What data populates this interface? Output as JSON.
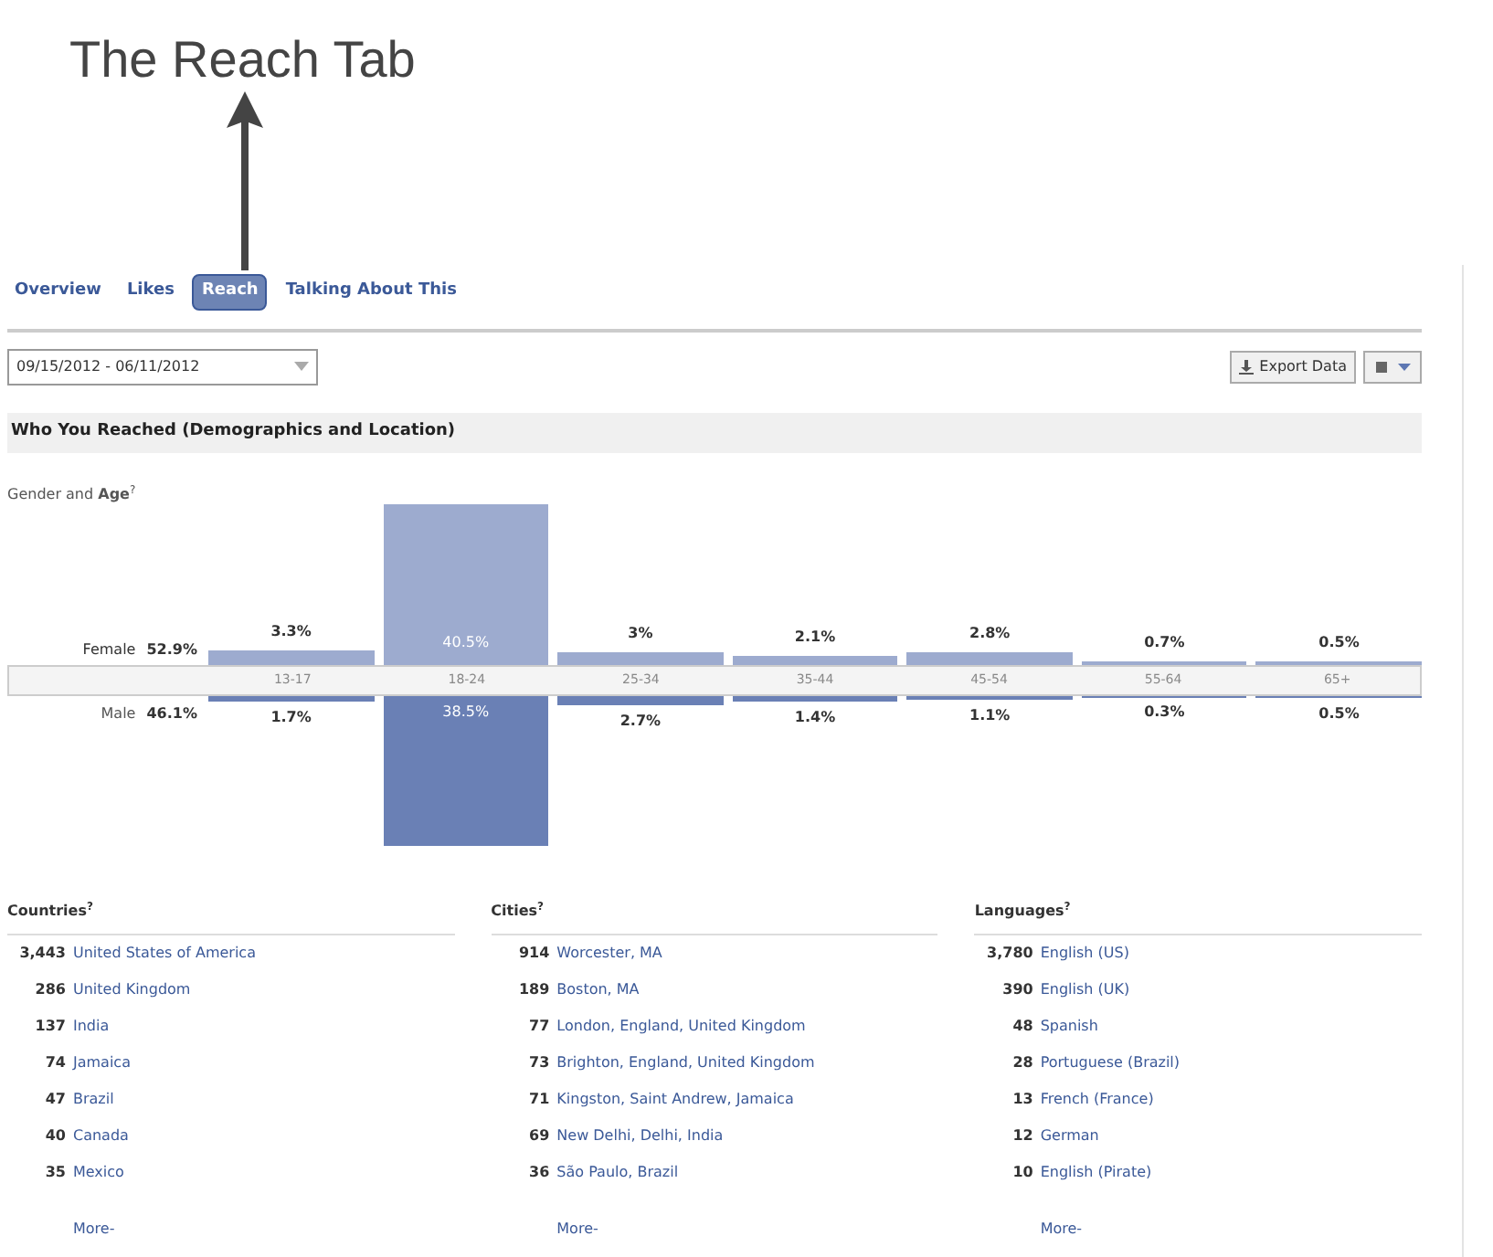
{
  "annotation": {
    "title": "The Reach Tab"
  },
  "tabs": [
    {
      "label": "Overview",
      "selected": false
    },
    {
      "label": "Likes",
      "selected": false
    },
    {
      "label": "Reach",
      "selected": true
    },
    {
      "label": "Talking About This",
      "selected": false
    }
  ],
  "date_range": {
    "value": "09/15/2012 - 06/11/2012"
  },
  "export_button": "Export Data",
  "section": {
    "title": "Who You Reached (Demographics and Location)",
    "chart_title": "Gender and **Age**$^{?}$",
    "gender_totals": [
      {
        "label": "Female",
        "value": "52.9%"
      },
      {
        "label": "Male",
        "value": "46.1%"
      }
    ],
    "age_groups": [
      {
        "label": "13-17",
        "female": "3.3%",
        "male": "1.7%"
      },
      {
        "label": "18-24",
        "female": "40.5%",
        "male": "38.5%"
      },
      {
        "label": "25-34",
        "female": "3%",
        "male": "2.7%"
      },
      {
        "label": "35-44",
        "female": "2.1%",
        "male": "1.4%"
      },
      {
        "label": "45-54",
        "female": "2.8%",
        "male": "1.1%"
      },
      {
        "label": "55-64",
        "female": "0.7%",
        "male": "0.3%"
      },
      {
        "label": "65+",
        "female": "0.5%",
        "male": "0.5%"
      }
    ]
  },
  "lists": [
    {
      "title": "Countries$^{?}$",
      "rows": [
        {
          "count": "3,443",
          "name": "United States of America"
        },
        {
          "count": "286",
          "name": "United Kingdom"
        },
        {
          "count": "137",
          "name": "India"
        },
        {
          "count": "74",
          "name": "Jamaica"
        },
        {
          "count": "47",
          "name": "Brazil"
        },
        {
          "count": "40",
          "name": "Canada"
        },
        {
          "count": "35",
          "name": "Mexico"
        }
      ],
      "more": "More-"
    },
    {
      "title": "Cities$^{?}$",
      "rows": [
        {
          "count": "914",
          "name": "Worcester, MA"
        },
        {
          "count": "189",
          "name": "Boston, MA"
        },
        {
          "count": "77",
          "name": "London, England, United Kingdom"
        },
        {
          "count": "73",
          "name": "Brighton, England, United Kingdom"
        },
        {
          "count": "71",
          "name": "Kingston, Saint Andrew, Jamaica"
        },
        {
          "count": "69",
          "name": "New Delhi, Delhi, India"
        },
        {
          "count": "36",
          "name": "São Paulo, Brazil"
        }
      ],
      "more": "More-"
    },
    {
      "title": "Languages$^{?}$",
      "rows": [
        {
          "count": "3,780",
          "name": "English (US)"
        },
        {
          "count": "390",
          "name": "English (UK)"
        },
        {
          "count": "48",
          "name": "Spanish"
        },
        {
          "count": "28",
          "name": "Portuguese (Brazil)"
        },
        {
          "count": "13",
          "name": "French (France)"
        },
        {
          "count": "12",
          "name": "German"
        },
        {
          "count": "10",
          "name": "English (Pirate)"
        }
      ],
      "more": "More-"
    }
  ]
}
